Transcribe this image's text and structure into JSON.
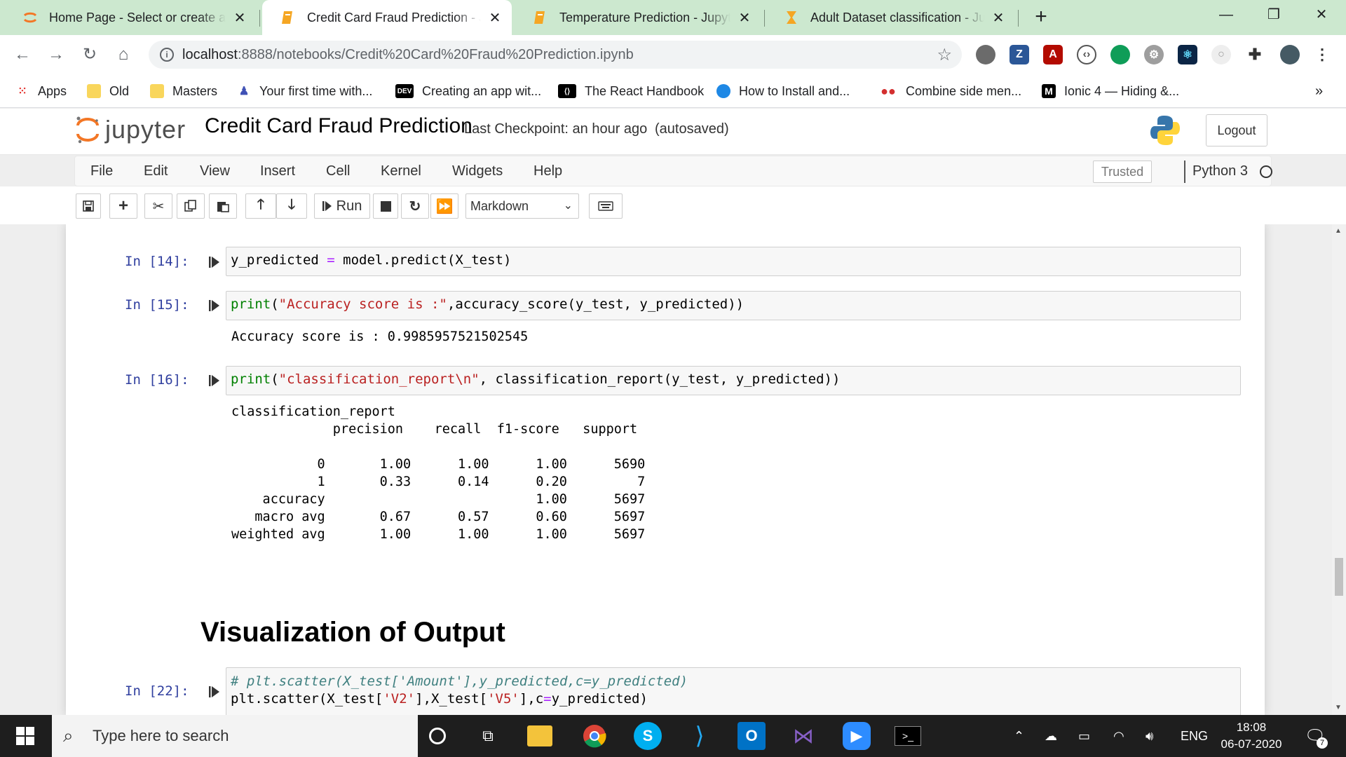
{
  "browser": {
    "tabs": [
      {
        "title": "Home Page - Select or create a notebook",
        "icon": "jupyter-tab-icon",
        "active": false
      },
      {
        "title": "Credit Card Fraud Prediction - Jupyter Notebook",
        "icon": "notebook-tab-icon",
        "active": true
      },
      {
        "title": "Temperature Prediction - Jupyter Notebook",
        "icon": "notebook-tab-icon",
        "active": false
      },
      {
        "title": "Adult Dataset classification - Jupyter Notebook",
        "icon": "hourglass-tab-icon",
        "active": false
      }
    ],
    "url_host": "localhost",
    "url_path": ":8888/notebooks/Credit%20Card%20Fraud%20Prediction.ipynb",
    "bookmarks": [
      {
        "label": "Apps",
        "icon": "apps-grid-icon"
      },
      {
        "label": "Old",
        "icon": "folder-icon"
      },
      {
        "label": "Masters",
        "icon": "folder-icon"
      },
      {
        "label": "Your first time with...",
        "icon": "person-icon"
      },
      {
        "label": "Creating an app wit...",
        "icon": "dev-icon"
      },
      {
        "label": "The React Handbook",
        "icon": "react-handbook-icon"
      },
      {
        "label": "How to Install and...",
        "icon": "globe-icon"
      },
      {
        "label": "Combine side men...",
        "icon": "dots-icon"
      },
      {
        "label": "Ionic 4 — Hiding &...",
        "icon": "medium-icon"
      }
    ],
    "bookmarks_overflow": "»"
  },
  "jupyter": {
    "logo_text": "jupyter",
    "notebook_name": "Credit Card Fraud Prediction",
    "checkpoint": "Last Checkpoint: an hour ago",
    "autosave": "(autosaved)",
    "logout": "Logout",
    "menus": [
      "File",
      "Edit",
      "View",
      "Insert",
      "Cell",
      "Kernel",
      "Widgets",
      "Help"
    ],
    "trusted": "Trusted",
    "kernel": "Python 3",
    "run_label": "Run",
    "cell_type": "Markdown"
  },
  "cells": {
    "c14": {
      "prompt": "In [14]:"
    },
    "c15": {
      "prompt": "In [15]:",
      "output": "Accuracy score is : 0.9985957521502545"
    },
    "c16": {
      "prompt": "In [16]:"
    },
    "report_title": "classification_report",
    "report_header": "             precision    recall  f1-score   support",
    "report_rows": [
      "           0       1.00      1.00      1.00      5690",
      "           1       0.33      0.14      0.20         7",
      "",
      "    accuracy                           1.00      5697",
      "   macro avg       0.67      0.57      0.60      5697",
      "weighted avg       1.00      1.00      1.00      5697"
    ],
    "heading": "Visualization of Output",
    "c22": {
      "prompt": "In [22]:"
    }
  },
  "taskbar": {
    "search_placeholder": "Type here to search",
    "lang": "ENG",
    "time": "18:08",
    "date": "06-07-2020",
    "notifications": "7"
  }
}
